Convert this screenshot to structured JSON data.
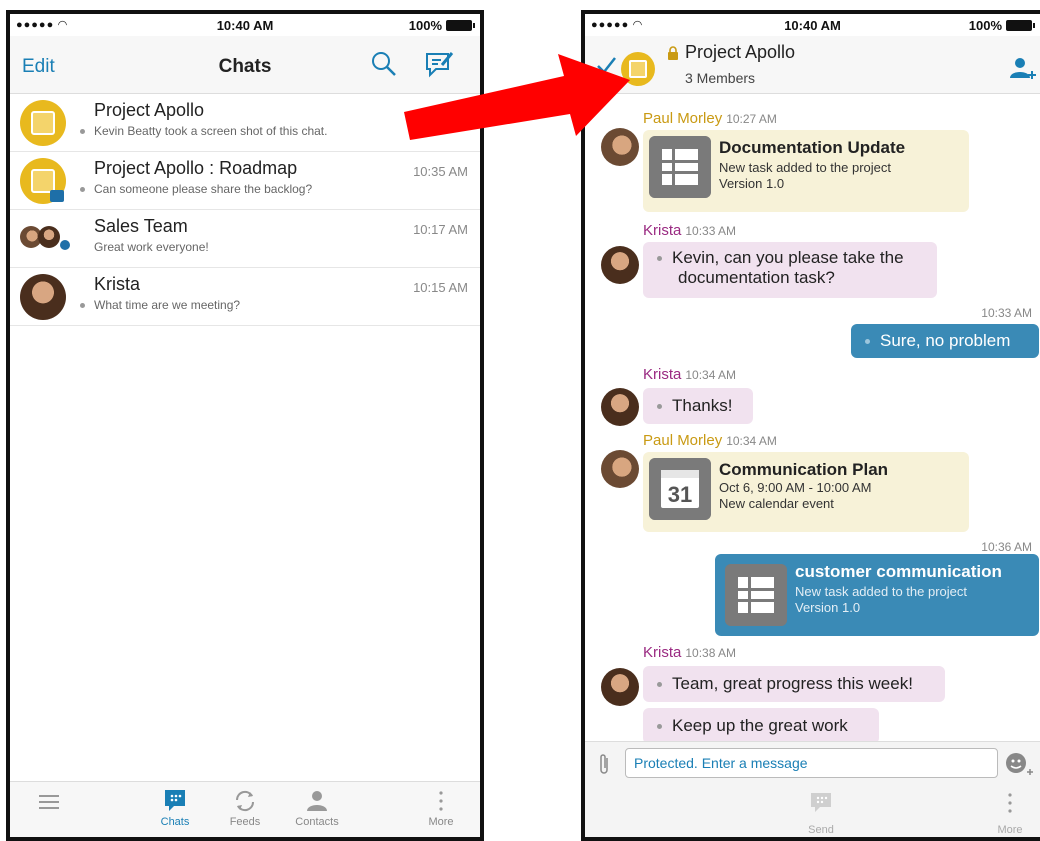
{
  "status": {
    "time": "10:40 AM",
    "battery": "100%"
  },
  "left": {
    "header": {
      "edit": "Edit",
      "title": "Chats"
    },
    "chats": [
      {
        "name": "Project Apollo",
        "preview": "Kevin Beatty took a screen shot of this chat.",
        "time": ""
      },
      {
        "name": "Project Apollo : Roadmap",
        "preview": "Can someone please share the backlog?",
        "time": "10:35 AM"
      },
      {
        "name": "Sales Team",
        "preview": "Great work everyone!",
        "time": "10:17 AM"
      },
      {
        "name": "Krista",
        "preview": "What time are we meeting?",
        "time": "10:15 AM"
      }
    ],
    "tabs": {
      "chats": "Chats",
      "feeds": "Feeds",
      "contacts": "Contacts",
      "more": "More"
    }
  },
  "right": {
    "header": {
      "title": "Project Apollo",
      "members": "3 Members"
    },
    "messages": {
      "m1": {
        "sender": "Paul Morley",
        "time": "10:27 AM",
        "card_title": "Documentation Update",
        "line1": "New task added to the project",
        "line2": "Version 1.0"
      },
      "m2": {
        "sender": "Krista",
        "time": "10:33 AM",
        "text_line1": "Kevin, can you please take the",
        "text_line2": "documentation task?"
      },
      "m3": {
        "time": "10:33 AM",
        "text": "Sure, no problem"
      },
      "m4": {
        "sender": "Krista",
        "time": "10:34 AM",
        "text": "Thanks!"
      },
      "m5": {
        "sender": "Paul Morley",
        "time": "10:34 AM",
        "card_title": "Communication Plan",
        "line1": "Oct 6, 9:00 AM - 10:00 AM",
        "line2": "New calendar event",
        "cal_day": "31"
      },
      "m6": {
        "time": "10:36 AM",
        "card_title": "customer communication",
        "line1": "New task added to the project",
        "line2": "Version 1.0"
      },
      "m7": {
        "sender": "Krista",
        "time": "10:38 AM",
        "text1": "Team, great progress this week!",
        "text2": "Keep up the great work"
      }
    },
    "compose": {
      "placeholder": "Protected. Enter a message"
    },
    "bottom": {
      "send": "Send",
      "more": "More"
    }
  },
  "colors": {
    "accent_blue": "#1a7fb5",
    "brand_yellow": "#e8b91e",
    "outgoing_bubble": "#3a8ab6",
    "arrow_red": "#ff0000"
  }
}
